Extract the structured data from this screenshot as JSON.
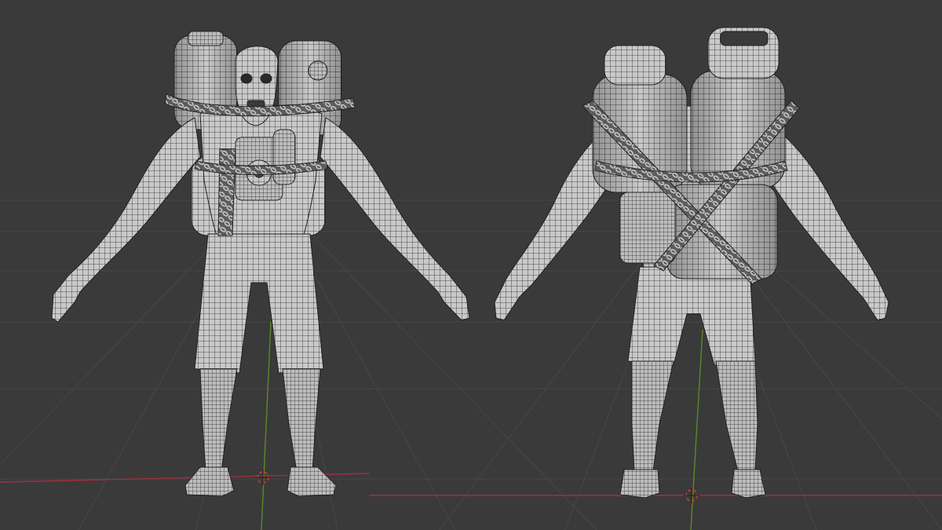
{
  "viewport": {
    "background": "#3a3a3a",
    "grid_color": "#474747",
    "x_axis_color": "#a03040",
    "y_axis_color": "#5a8a2a",
    "cursor_color": "#c8403a",
    "shading": "solid-wireframe",
    "views": [
      "front",
      "back"
    ]
  },
  "icons": {
    "cursor": "3d-cursor-icon"
  }
}
